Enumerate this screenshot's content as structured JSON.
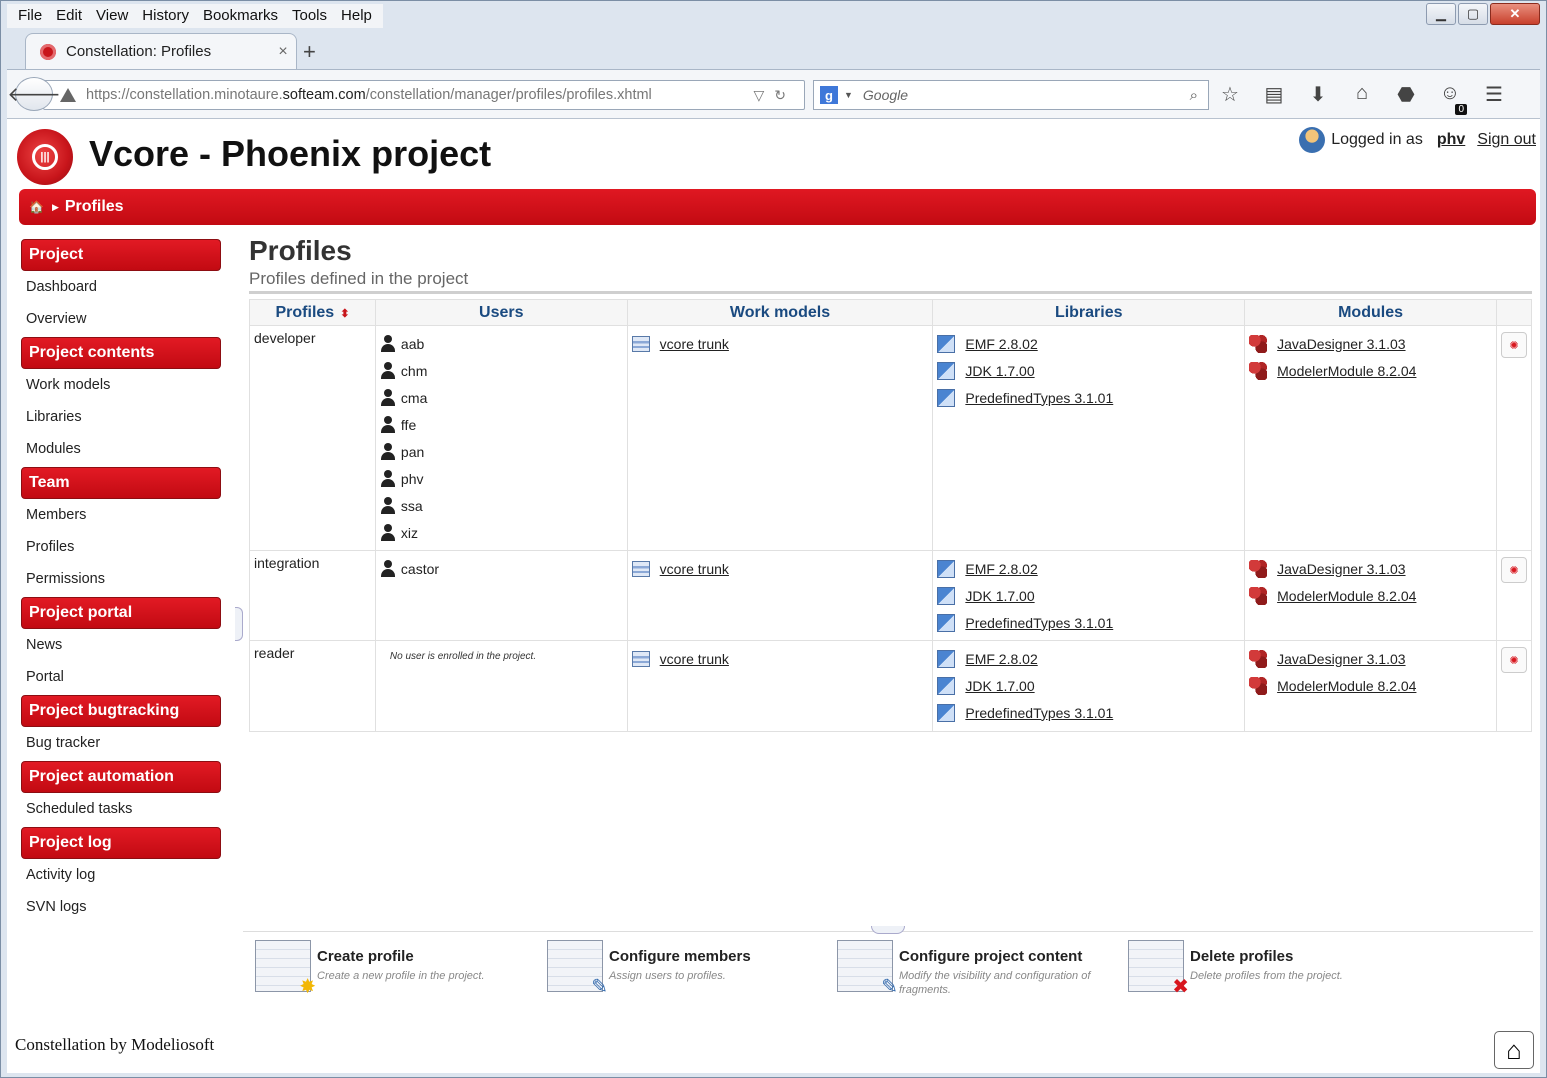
{
  "browser": {
    "menu": [
      "File",
      "Edit",
      "View",
      "History",
      "Bookmarks",
      "Tools",
      "Help"
    ],
    "tab_title": "Constellation: Profiles",
    "tab_close": "×",
    "new_tab": "+",
    "url_prefix": "https://constellation.minotaure.",
    "url_host": "softeam.com",
    "url_path": "/constellation/manager/profiles/profiles.xhtml",
    "search_engine": "g",
    "search_placeholder": "Google",
    "addon_count": "0"
  },
  "header": {
    "project_title": "Vcore - Phoenix project",
    "logged_in_label": "Logged in as",
    "username": "phv",
    "sign_out": "Sign out",
    "breadcrumb_current": "Profiles"
  },
  "sidebar": {
    "sections": [
      {
        "title": "Project",
        "links": [
          "Dashboard",
          "Overview"
        ]
      },
      {
        "title": "Project contents",
        "links": [
          "Work models",
          "Libraries",
          "Modules"
        ]
      },
      {
        "title": "Team",
        "links": [
          "Members",
          "Profiles",
          "Permissions"
        ]
      },
      {
        "title": "Project portal",
        "links": [
          "News",
          "Portal"
        ]
      },
      {
        "title": "Project bugtracking",
        "links": [
          "Bug tracker"
        ]
      },
      {
        "title": "Project automation",
        "links": [
          "Scheduled tasks"
        ]
      },
      {
        "title": "Project log",
        "links": [
          "Activity log",
          "SVN logs"
        ]
      }
    ]
  },
  "main": {
    "title": "Profiles",
    "subtitle": "Profiles defined in the project",
    "columns": [
      "Profiles",
      "Users",
      "Work models",
      "Libraries",
      "Modules"
    ],
    "rows": [
      {
        "profile": "developer",
        "users": [
          "aab",
          "chm",
          "cma",
          "ffe",
          "pan",
          "phv",
          "ssa",
          "xiz"
        ],
        "no_users_text": "",
        "work_models": [
          "vcore trunk"
        ],
        "libraries": [
          "EMF 2.8.02",
          "JDK 1.7.00",
          "PredefinedTypes 3.1.01"
        ],
        "modules": [
          "JavaDesigner 3.1.03",
          "ModelerModule 8.2.04"
        ]
      },
      {
        "profile": "integration",
        "users": [
          "castor"
        ],
        "no_users_text": "",
        "work_models": [
          "vcore trunk"
        ],
        "libraries": [
          "EMF 2.8.02",
          "JDK 1.7.00",
          "PredefinedTypes 3.1.01"
        ],
        "modules": [
          "JavaDesigner 3.1.03",
          "ModelerModule 8.2.04"
        ]
      },
      {
        "profile": "reader",
        "users": [],
        "no_users_text": "No user is enrolled in the project.",
        "work_models": [
          "vcore trunk"
        ],
        "libraries": [
          "EMF 2.8.02",
          "JDK 1.7.00",
          "PredefinedTypes 3.1.01"
        ],
        "modules": [
          "JavaDesigner 3.1.03",
          "ModelerModule 8.2.04"
        ]
      }
    ]
  },
  "actions": [
    {
      "title": "Create profile",
      "desc": "Create a new profile in the project.",
      "icon": "create-profile-icon"
    },
    {
      "title": "Configure members",
      "desc": "Assign users to profiles.",
      "icon": "configure-members-icon"
    },
    {
      "title": "Configure project content",
      "desc": "Modify the visibility and configuration of fragments.",
      "icon": "configure-content-icon"
    },
    {
      "title": "Delete profiles",
      "desc": "Delete profiles from the project.",
      "icon": "delete-profiles-icon"
    }
  ],
  "footer": {
    "text": "Constellation by Modeliosoft"
  },
  "colors": {
    "accent_red": "#c8151b",
    "header_blue": "#1a4a80"
  }
}
